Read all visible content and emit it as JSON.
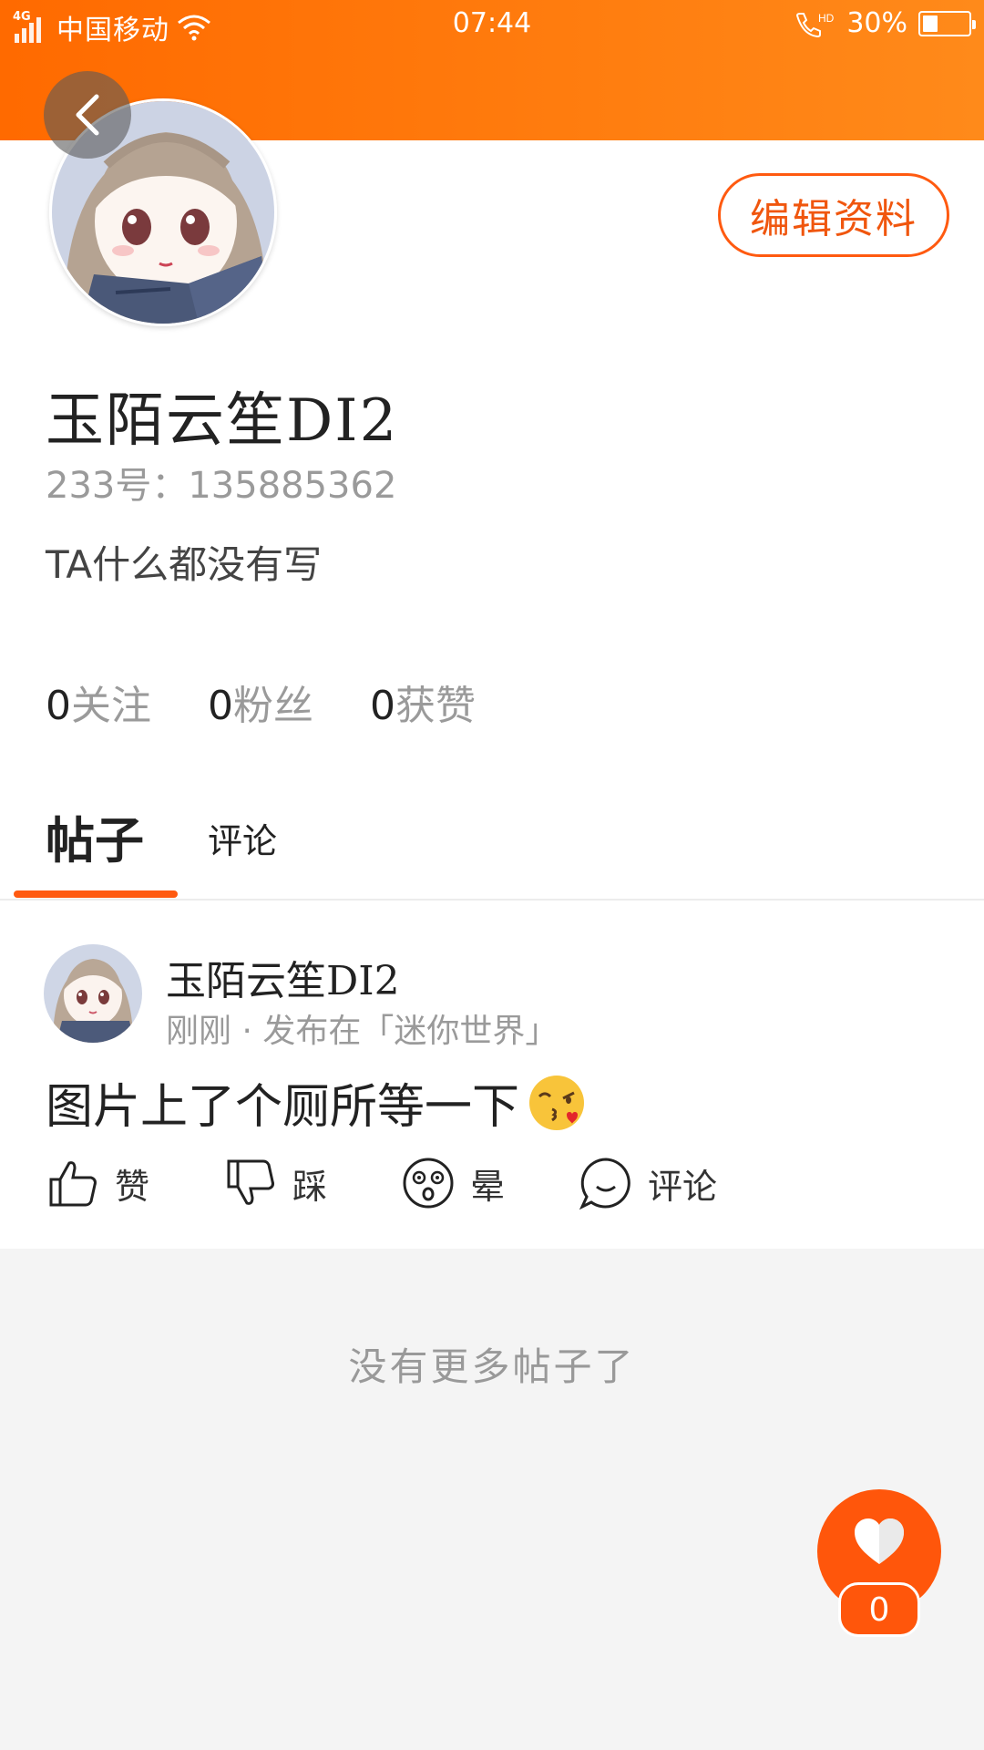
{
  "status_bar": {
    "network": "4G",
    "carrier": "中国移动",
    "time": "07:44",
    "call_tag": "HD",
    "battery": "30%",
    "battery_level": 0.3
  },
  "profile": {
    "edit_label": "编辑资料",
    "username": "玉陌云笙DI2",
    "id_text": "233号：135885362",
    "bio": "TA什么都没有写",
    "stats": [
      {
        "num": "0",
        "label": "关注"
      },
      {
        "num": "0",
        "label": "粉丝"
      },
      {
        "num": "0",
        "label": "获赞"
      }
    ]
  },
  "tabs": [
    {
      "label": "帖子",
      "active": true
    },
    {
      "label": "评论",
      "active": false
    }
  ],
  "post": {
    "author": "玉陌云笙DI2",
    "meta": "刚刚 · 发布在「迷你世界」",
    "text": "图片上了个厕所等一下",
    "actions": [
      {
        "icon": "thumbs-up-icon",
        "label": "赞"
      },
      {
        "icon": "thumbs-down-icon",
        "label": "踩"
      },
      {
        "icon": "dizzy-face-icon",
        "label": "晕"
      },
      {
        "icon": "comment-icon",
        "label": "评论"
      }
    ]
  },
  "footer": {
    "no_more": "没有更多帖子了"
  },
  "like_fab": {
    "count": "0"
  },
  "colors": {
    "accent": "#ff5a10",
    "header": "#ff7a10"
  }
}
